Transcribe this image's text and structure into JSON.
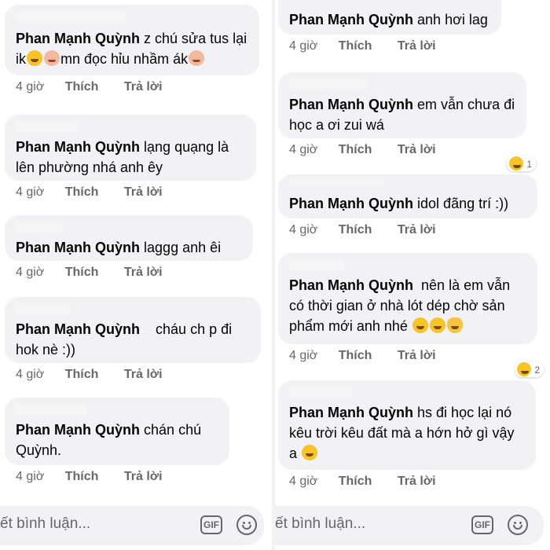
{
  "left": {
    "comments": [
      {
        "author": "Phan Mạnh Quỳnh",
        "text_parts": [
          "z chú sửa tus lại ik",
          "mn đọc hỉu nhầm ák",
          ""
        ],
        "time": "4 giờ",
        "like": "Thích",
        "reply": "Trả lời"
      },
      {
        "author": "Phan Mạnh Quỳnh",
        "text": "lạng quạng là lên phường nhá anh êy",
        "time": "4 giờ",
        "like": "Thích",
        "reply": "Trả lời"
      },
      {
        "author": "Phan Mạnh Quỳnh",
        "text": "laggg anh êi",
        "time": "4 giờ",
        "like": "Thích",
        "reply": "Trả lời"
      },
      {
        "author": "Phan Mạnh Quỳnh",
        "text": "cháu ch p đi hok nè :))",
        "time": "4 giờ",
        "like": "Thích",
        "reply": "Trả lời"
      },
      {
        "author": "Phan Mạnh Quỳnh",
        "text": "chán chú Quỳnh.",
        "time": "4 giờ",
        "like": "Thích",
        "reply": "Trả lời"
      }
    ],
    "input": {
      "placeholder": "ết bình luận...",
      "gif": "GIF"
    }
  },
  "right": {
    "comments": [
      {
        "author": "Phan Mạnh Quỳnh",
        "text": "anh hơi lag",
        "time": "4 giờ",
        "like": "Thích",
        "reply": "Trả lời"
      },
      {
        "author": "Phan Mạnh Quỳnh",
        "text": "em vẫn chưa đi học a ơi zui wá",
        "time": "4 giờ",
        "like": "Thích",
        "reply": "Trả lời",
        "reaction_count": "1"
      },
      {
        "author": "Phan Mạnh Quỳnh",
        "text": "idol đãng trí :))",
        "time": "4 giờ",
        "like": "Thích",
        "reply": "Trả lời"
      },
      {
        "author": "Phan Mạnh Quỳnh",
        "text": "nên là em vẫn có thời gian ở nhà lót dép chờ sản phẩm mới anh nhé",
        "time": "4 giờ",
        "like": "Thích",
        "reply": "Trả lời",
        "reaction_count": "2"
      },
      {
        "author": "Phan Mạnh Quỳnh",
        "text": "hs đi học lại nó kêu trời kêu đất mà a hớn hở gì vậy a",
        "time": "4 giờ",
        "like": "Thích",
        "reply": "Trả lời"
      }
    ],
    "input": {
      "placeholder": "ết bình luận...",
      "gif": "GIF"
    }
  },
  "icons": {
    "laugh_emoji": "laughing-emoji-icon",
    "person_emoji": "person-emoji-icon",
    "smile": "smile-icon",
    "ok_hand": "ok-hand-emoji-icon"
  },
  "colors": {
    "bubble": "#f0f2f5",
    "text": "#050505",
    "meta": "#65676b"
  }
}
